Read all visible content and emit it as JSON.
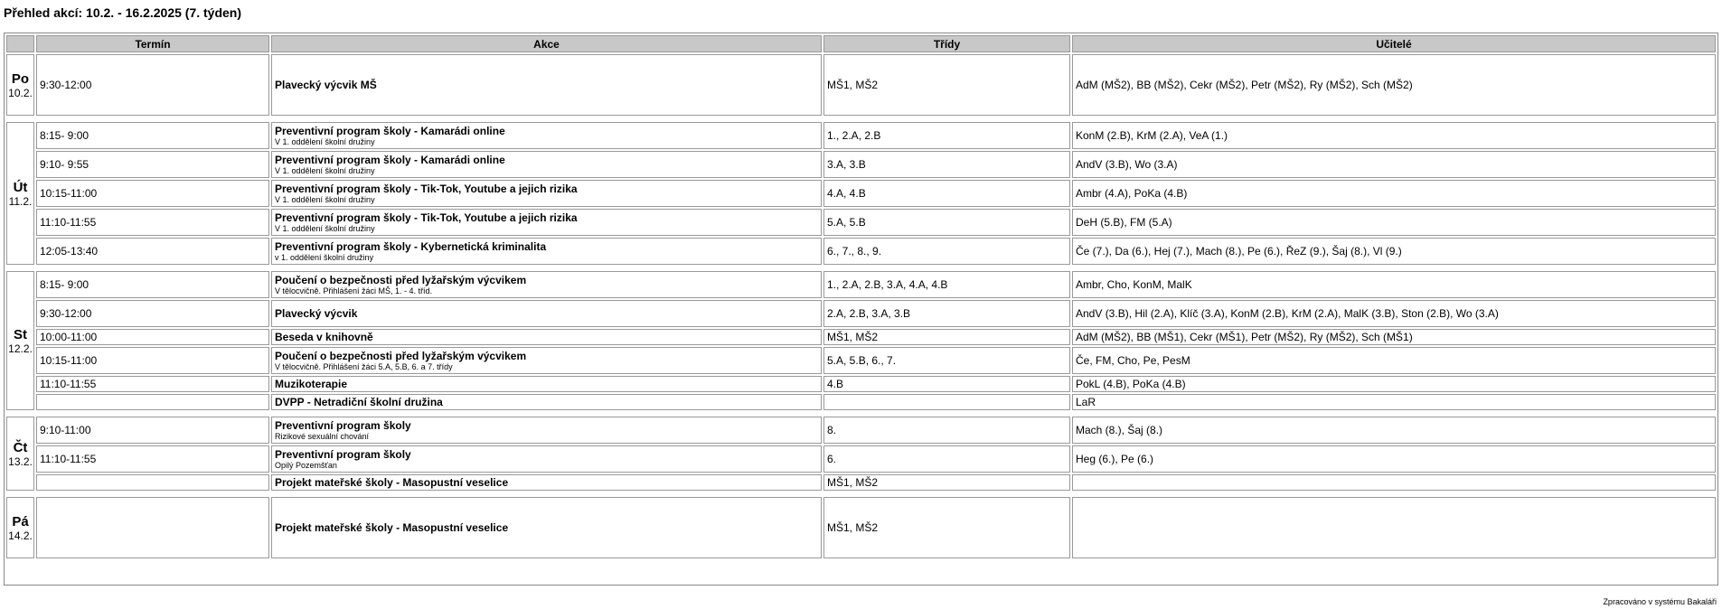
{
  "title": "Přehled akcí: 10.2. - 16.2.2025 (7. týden)",
  "columns": [
    "Termín",
    "Akce",
    "Třídy",
    "Učitelé"
  ],
  "days": [
    {
      "name": "Po",
      "date": "10.2.",
      "rows": [
        {
          "time": "9:30-12:00",
          "title": "Plavecký výcvik MŠ",
          "note": "",
          "classes": "MŠ1, MŠ2",
          "teachers": "AdM (MŠ2), BB (MŠ2), Cekr (MŠ2), Petr (MŠ2), Ry (MŠ2), Sch (MŠ2)"
        }
      ]
    },
    {
      "name": "Út",
      "date": "11.2.",
      "rows": [
        {
          "time": "8:15- 9:00",
          "title": "Preventivní program školy - Kamarádi online",
          "note": "V 1. oddělení školní družiny",
          "classes": "1., 2.A, 2.B",
          "teachers": "KonM (2.B), KrM (2.A), VeA (1.)"
        },
        {
          "time": "9:10- 9:55",
          "title": "Preventivní program školy - Kamarádi online",
          "note": "V 1. oddělení školní družiny",
          "classes": "3.A, 3.B",
          "teachers": "AndV (3.B), Wo (3.A)"
        },
        {
          "time": "10:15-11:00",
          "title": "Preventivní program školy - Tik-Tok, Youtube a jejich rizika",
          "note": "V 1. oddělení školní družiny",
          "classes": "4.A, 4.B",
          "teachers": "Ambr (4.A), PoKa (4.B)"
        },
        {
          "time": "11:10-11:55",
          "title": "Preventivní program školy - Tik-Tok, Youtube a jejich rizika",
          "note": "V 1. oddělení školní družiny",
          "classes": "5.A, 5.B",
          "teachers": "DeH (5.B), FM (5.A)"
        },
        {
          "time": "12:05-13:40",
          "title": "Preventivní program školy - Kybernetická kriminalita",
          "note": "v 1. oddělení školní družiny",
          "classes": "6., 7., 8., 9.",
          "teachers": "Če (7.), Da (6.), Hej (7.), Mach (8.), Pe (6.), ŘeZ (9.), Šaj (8.), Vl (9.)"
        }
      ]
    },
    {
      "name": "St",
      "date": "12.2.",
      "rows": [
        {
          "time": "8:15- 9:00",
          "title": "Poučení o bezpečnosti před lyžařským výcvikem",
          "note": "V tělocvičně. Přihlášení žáci MŠ, 1. - 4. tříd.",
          "classes": "1., 2.A, 2.B, 3.A, 4.A, 4.B",
          "teachers": "Ambr, Cho, KonM, MalK"
        },
        {
          "time": "9:30-12:00",
          "title": "Plavecký výcvik",
          "note": "",
          "classes": "2.A, 2.B, 3.A, 3.B",
          "teachers": "AndV (3.B), Hil (2.A), Klíč (3.A), KonM (2.B), KrM (2.A), MalK (3.B), Ston (2.B), Wo (3.A)"
        },
        {
          "time": "10:00-11:00",
          "title": "Beseda v knihovně",
          "note": "",
          "classes": "MŠ1, MŠ2",
          "teachers": "AdM (MŠ2), BB (MŠ1), Cekr (MŠ1), Petr (MŠ2), Ry (MŠ2), Sch (MŠ1)",
          "low": true
        },
        {
          "time": "10:15-11:00",
          "title": "Poučení o bezpečnosti před lyžařským výcvikem",
          "note": "V tělocvičně. Přihlášení žáci 5.A, 5.B, 6. a 7. třídy",
          "classes": "5.A, 5.B, 6., 7.",
          "teachers": "Če, FM, Cho, Pe, PesM"
        },
        {
          "time": "11:10-11:55",
          "title": "Muzikoterapie",
          "note": "",
          "classes": "4.B",
          "teachers": "PokL (4.B), PoKa (4.B)",
          "low": true
        },
        {
          "time": "",
          "title": "DVPP - Netradiční školní družina",
          "note": "",
          "classes": "",
          "teachers": "LaR",
          "low": true
        }
      ]
    },
    {
      "name": "Čt",
      "date": "13.2.",
      "rows": [
        {
          "time": "9:10-11:00",
          "title": "Preventivní program školy",
          "note": "Rizikové sexuální chování",
          "classes": "8.",
          "teachers": "Mach (8.), Šaj (8.)"
        },
        {
          "time": "11:10-11:55",
          "title": "Preventivní program školy",
          "note": "Opilý Pozemšťan",
          "classes": "6.",
          "teachers": "Heg (6.), Pe (6.)"
        },
        {
          "time": "",
          "title": "Projekt mateřské školy - Masopustní veselice",
          "note": "",
          "classes": "MŠ1, MŠ2",
          "teachers": "",
          "low": true
        }
      ]
    },
    {
      "name": "Pá",
      "date": "14.2.",
      "rows": [
        {
          "time": "",
          "title": "Projekt mateřské školy - Masopustní veselice",
          "note": "",
          "classes": "MŠ1, MŠ2",
          "teachers": ""
        }
      ]
    }
  ],
  "footer": "Zpracováno v systému Bakaláři"
}
